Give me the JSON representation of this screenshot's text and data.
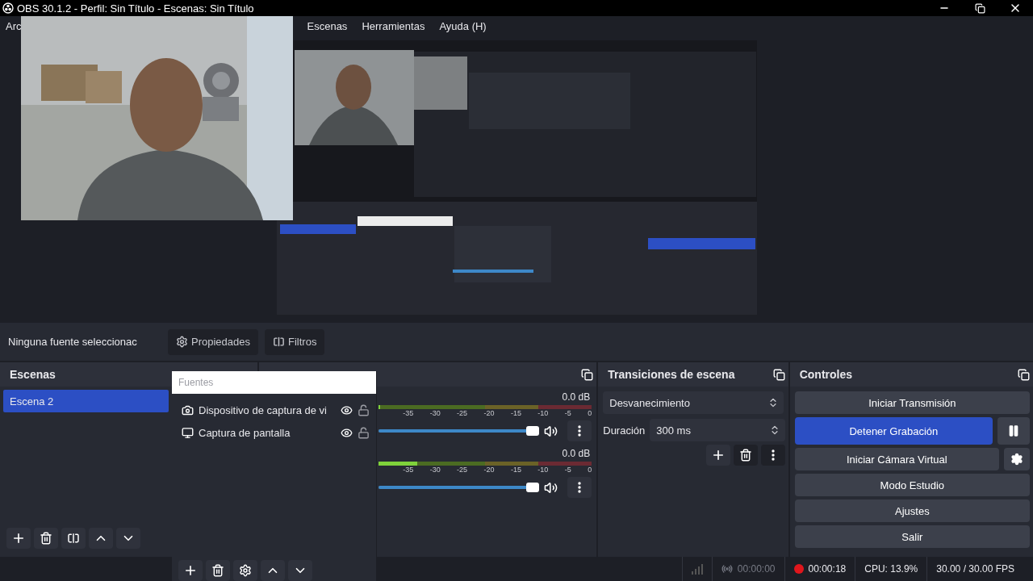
{
  "window": {
    "title": "OBS 30.1.2 - Perfil: Sin Título - Escenas: Sin Título"
  },
  "menu": [
    "Arc",
    "Escenas",
    "Herramientas",
    "Ayuda (H)"
  ],
  "webcam": {
    "kind": "picture"
  },
  "preview": {
    "kind": "picture"
  },
  "source_toolbar": {
    "status": "Ninguna fuente seleccionac",
    "buttons": [
      {
        "label": "Propiedades"
      },
      {
        "label": "Filtros"
      }
    ]
  },
  "scenes": {
    "title": "Escenas",
    "items": [
      {
        "label": "Escena 2",
        "selected": true
      }
    ]
  },
  "sources": {
    "title": "Fuentes",
    "items": [
      {
        "label": "Dispositivo de captura de vi",
        "kind": "camera",
        "visible": true,
        "locked": false
      },
      {
        "label": "Captura de pantalla",
        "kind": "display",
        "visible": true,
        "locked": false
      }
    ]
  },
  "mixer": {
    "channels": [
      {
        "reading": "0.0 dB",
        "meter": {
          "level": 0
        },
        "volume": {
          "level": 1
        },
        "ticks": [
          "-35",
          "-30",
          "-25",
          "-20",
          "-15",
          "-10",
          "-5",
          "0"
        ]
      },
      {
        "reading": "0.0 dB",
        "meter": {
          "level": 0.18
        },
        "volume": {
          "level": 1
        },
        "ticks": [
          "-35",
          "-30",
          "-25",
          "-20",
          "-15",
          "-10",
          "-5",
          "0"
        ]
      }
    ]
  },
  "transitions": {
    "title": "Transiciones de escena",
    "transition": "Desvanecimiento",
    "duration_label": "Duración",
    "duration": "300 ms"
  },
  "controls": {
    "title": "Controles",
    "buttons": [
      {
        "label": "Iniciar Transmisión",
        "active": false,
        "kind": "plain"
      },
      {
        "label": "Detener Grabación",
        "active": true,
        "kind": "pausable"
      },
      {
        "label": "Iniciar Cámara Virtual",
        "active": false,
        "kind": "configurable"
      },
      {
        "label": "Modo Estudio",
        "active": false,
        "kind": "plain"
      },
      {
        "label": "Ajustes",
        "active": false,
        "kind": "plain"
      },
      {
        "label": "Salir",
        "active": false,
        "kind": "plain"
      }
    ]
  },
  "status_bar": {
    "stream_time": "00:00:00",
    "record_time": "00:00:18",
    "recording": true,
    "cpu": "CPU: 13.9%",
    "fps": "30.00 / 30.00 FPS"
  }
}
